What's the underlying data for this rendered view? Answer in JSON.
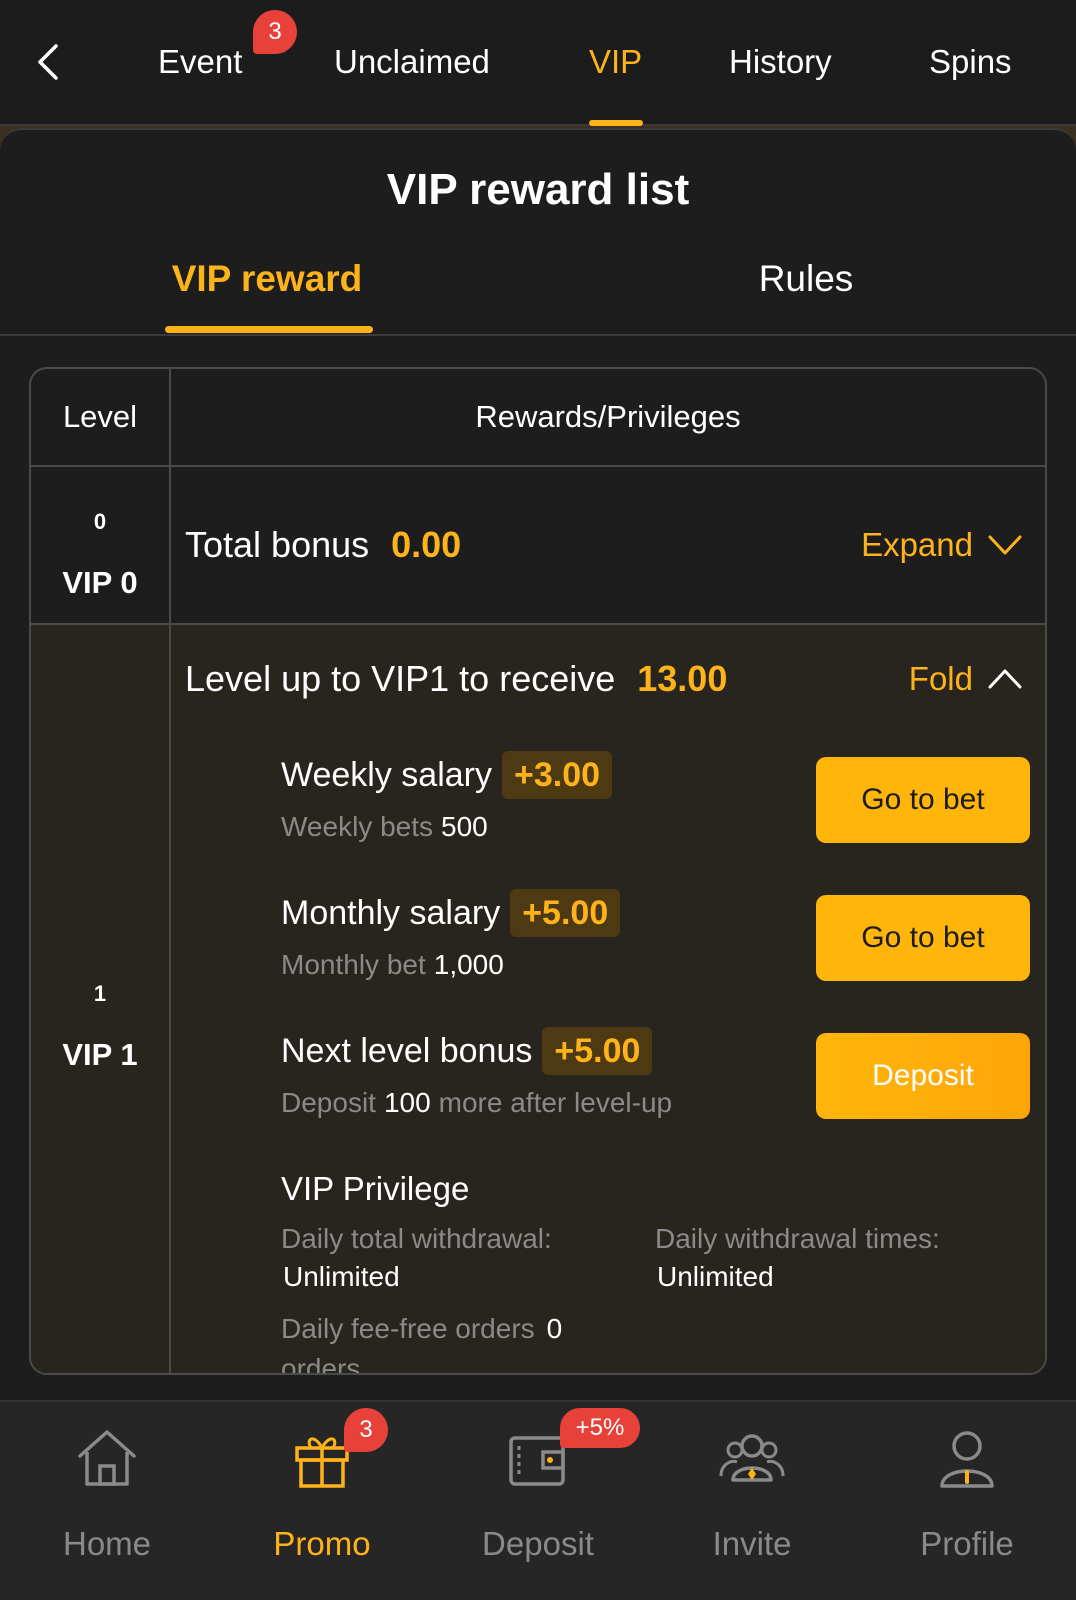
{
  "topnav": {
    "tabs": [
      {
        "label": "Event",
        "badge": "3"
      },
      {
        "label": "Unclaimed"
      },
      {
        "label": "VIP"
      },
      {
        "label": "History"
      },
      {
        "label": "Spins"
      }
    ],
    "active_tab": "VIP"
  },
  "sheet": {
    "title": "VIP reward list",
    "tabs": [
      {
        "label": "VIP reward"
      },
      {
        "label": "Rules"
      }
    ],
    "active_tab": "VIP reward"
  },
  "table": {
    "headers": {
      "level": "Level",
      "rewards": "Rewards/Privileges"
    },
    "rows": [
      {
        "level_num": "0",
        "level_name": "VIP 0",
        "summary_label": "Total bonus",
        "summary_value": "0.00",
        "toggle": "Expand"
      },
      {
        "level_num": "1",
        "level_name": "VIP 1",
        "summary_label": "Level up to VIP1 to receive",
        "summary_value": "13.00",
        "toggle": "Fold",
        "items": [
          {
            "title": "Weekly salary",
            "amount": "+3.00",
            "sub_label": "Weekly bets",
            "sub_value": "500",
            "sub_tail": "",
            "button": "Go to bet"
          },
          {
            "title": "Monthly salary",
            "amount": "+5.00",
            "sub_label": "Monthly bet",
            "sub_value": "1,000",
            "sub_tail": "",
            "button": "Go to bet"
          },
          {
            "title": "Next level bonus",
            "amount": "+5.00",
            "sub_label": "Deposit",
            "sub_value": "100",
            "sub_tail": "more after level-up",
            "button": "Deposit"
          }
        ],
        "privilege": {
          "title": "VIP Privilege",
          "daily_total_withdrawal_label": "Daily total withdrawal:",
          "daily_total_withdrawal_value": "Unlimited",
          "daily_withdrawal_times_label": "Daily withdrawal times:",
          "daily_withdrawal_times_value": "Unlimited",
          "fee_free_label": "Daily fee-free orders",
          "fee_free_value": "0",
          "fee_free_unit": "orders"
        }
      }
    ]
  },
  "bottomnav": {
    "items": [
      {
        "label": "Home",
        "icon": "home-icon"
      },
      {
        "label": "Promo",
        "icon": "gift-icon",
        "badge": "3"
      },
      {
        "label": "Deposit",
        "icon": "wallet-icon",
        "badge": "+5%"
      },
      {
        "label": "Invite",
        "icon": "users-icon"
      },
      {
        "label": "Profile",
        "icon": "profile-icon"
      }
    ],
    "active": "Promo"
  },
  "colors": {
    "accent": "#ffb31a",
    "badge": "#e8413a",
    "background": "#1c1c1c",
    "expanded_row": "#28251e"
  }
}
